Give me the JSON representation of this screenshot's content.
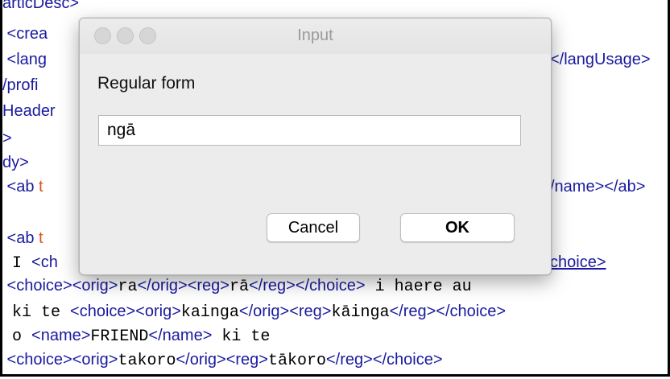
{
  "editor": {
    "lines": [
      {
        "segments": [
          {
            "t": "articDesc>",
            "c": "blue"
          }
        ]
      },
      {
        "segments": [
          {
            "t": " <crea",
            "c": "blue"
          }
        ]
      },
      {
        "segments": [
          {
            "t": " <lang",
            "c": "blue"
          },
          {
            "t": "",
            "c": "blue"
          }
        ],
        "right": "</langUsage>"
      },
      {
        "segments": [
          {
            "t": "/profi",
            "c": "blue"
          }
        ]
      },
      {
        "segments": [
          {
            "t": "Header",
            "c": "blue"
          }
        ]
      },
      {
        "segments": [
          {
            "t": ">",
            "c": "blue"
          }
        ]
      },
      {
        "segments": [
          {
            "t": "dy>",
            "c": "blue"
          }
        ]
      },
      {
        "segments": [
          {
            "t": " <ab ",
            "c": "blue"
          },
          {
            "t": "t",
            "c": "orange"
          }
        ],
        "right": "/name></ab>"
      },
      {
        "segments": [
          {
            "t": "",
            "c": "blue"
          }
        ]
      },
      {
        "segments": [
          {
            "t": " <ab ",
            "c": "blue"
          },
          {
            "t": "t",
            "c": "orange"
          }
        ]
      },
      {
        "segments": [
          {
            "t": " I ",
            "c": "black"
          },
          {
            "t": "<ch",
            "c": "blue"
          }
        ],
        "right": "choice>"
      },
      {
        "segments": [
          {
            "t": " <choice><orig>",
            "c": "blue"
          },
          {
            "t": "ra",
            "c": "black"
          },
          {
            "t": "</orig><reg>",
            "c": "blue"
          },
          {
            "t": "rā",
            "c": "black"
          },
          {
            "t": "</reg></choice>",
            "c": "blue"
          },
          {
            "t": " i haere au",
            "c": "black"
          }
        ]
      },
      {
        "segments": [
          {
            "t": " ki te ",
            "c": "black"
          },
          {
            "t": "<choice><orig>",
            "c": "blue"
          },
          {
            "t": "kainga",
            "c": "black"
          },
          {
            "t": "</orig><reg>",
            "c": "blue"
          },
          {
            "t": "kāinga",
            "c": "black"
          },
          {
            "t": "</reg></choice>",
            "c": "blue"
          }
        ]
      },
      {
        "segments": [
          {
            "t": " o ",
            "c": "black"
          },
          {
            "t": "<name>",
            "c": "blue"
          },
          {
            "t": "FRIEND",
            "c": "black"
          },
          {
            "t": "</name>",
            "c": "blue"
          },
          {
            "t": " ki te",
            "c": "black"
          }
        ]
      },
      {
        "segments": [
          {
            "t": " <choice><orig>",
            "c": "blue"
          },
          {
            "t": "takoro",
            "c": "black"
          },
          {
            "t": "</orig><reg>",
            "c": "blue"
          },
          {
            "t": "tākoro",
            "c": "black"
          },
          {
            "t": "</reg></choice>",
            "c": "blue"
          }
        ]
      }
    ]
  },
  "dialog": {
    "title": "Input",
    "label": "Regular form",
    "input_value": "ngā",
    "cancel_label": "Cancel",
    "ok_label": "OK"
  }
}
